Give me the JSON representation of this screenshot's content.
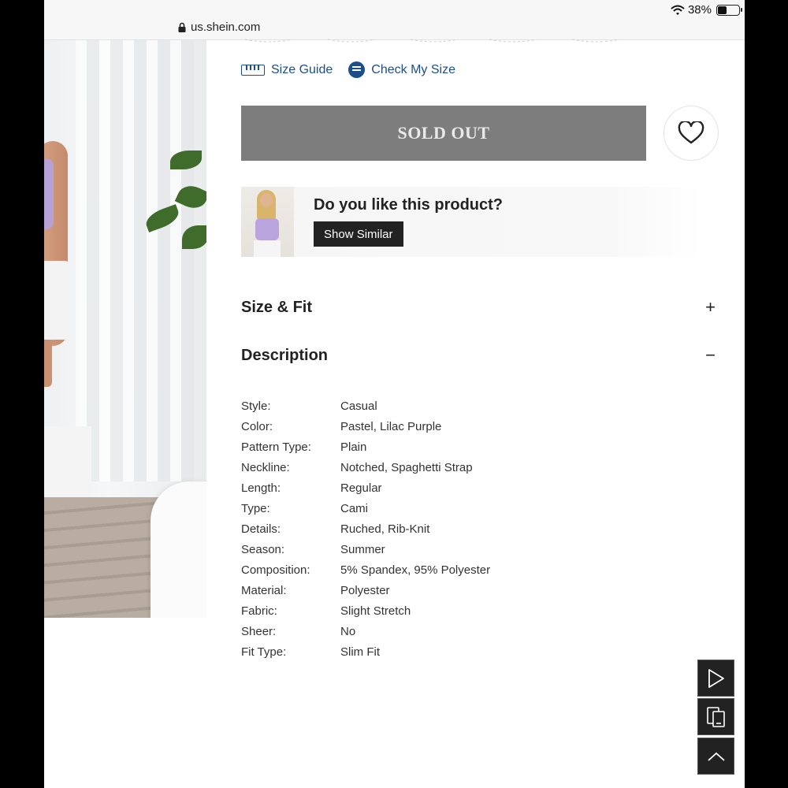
{
  "status_bar": {
    "battery_text": "38%",
    "battery_level": 0.38
  },
  "browser": {
    "url": "us.shein.com"
  },
  "product": {
    "size_guide_label": "Size Guide",
    "check_size_label": "Check My Size",
    "sold_out_label": "SOLD OUT",
    "promo": {
      "question": "Do you like this product?",
      "button_label": "Show Similar"
    }
  },
  "sections": {
    "size_fit": {
      "title": "Size & Fit",
      "toggle": "+"
    },
    "description": {
      "title": "Description",
      "toggle": "−"
    }
  },
  "attributes": [
    {
      "key": "Style:",
      "value": "Casual"
    },
    {
      "key": "Color:",
      "value": "Pastel, Lilac Purple"
    },
    {
      "key": "Pattern Type:",
      "value": "Plain"
    },
    {
      "key": "Neckline:",
      "value": "Notched, Spaghetti Strap"
    },
    {
      "key": "Length:",
      "value": "Regular"
    },
    {
      "key": "Type:",
      "value": "Cami"
    },
    {
      "key": "Details:",
      "value": "Ruched, Rib-Knit"
    },
    {
      "key": "Season:",
      "value": "Summer"
    },
    {
      "key": "Composition:",
      "value": "5% Spandex, 95% Polyester"
    },
    {
      "key": "Material:",
      "value": "Polyester"
    },
    {
      "key": "Fabric:",
      "value": "Slight Stretch"
    },
    {
      "key": "Sheer:",
      "value": "No"
    },
    {
      "key": "Fit Type:",
      "value": "Slim Fit"
    }
  ],
  "colors": {
    "link": "#1d4e89",
    "sold_out_bg": "#7d7d7d",
    "dark_button": "#222222"
  },
  "icons": [
    "wifi-icon",
    "battery-icon",
    "lock-icon",
    "ruler-icon",
    "check-size-icon",
    "heart-icon",
    "play-icon",
    "copy-icon",
    "chevron-up-icon"
  ]
}
